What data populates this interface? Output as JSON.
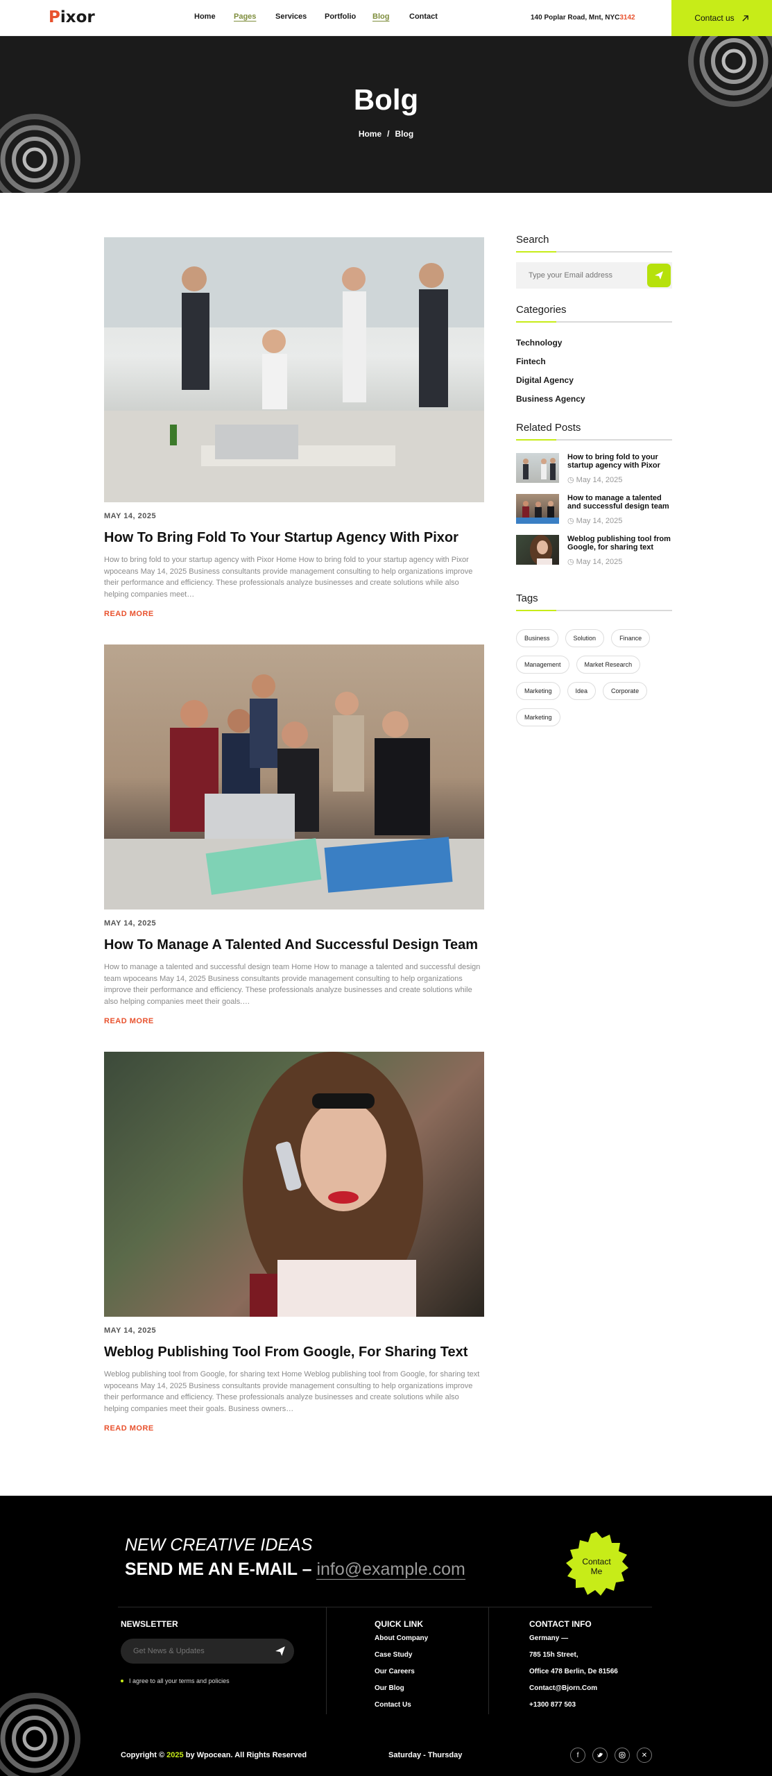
{
  "header": {
    "logo_initial": "P",
    "logo_rest": "ixor",
    "nav": [
      "Home",
      "Pages",
      "Services",
      "Portfolio",
      "Blog",
      "Contact"
    ],
    "address_main": "140 Poplar Road, Mnt, NYC",
    "address_accent": "3142",
    "contact_label": "Contact us",
    "accent_color": "#c7ec18",
    "brand_color": "#e8512d"
  },
  "hero": {
    "title": "Bolg",
    "crumb_home": "Home",
    "crumb_sep": "/",
    "crumb_current": "Blog"
  },
  "posts": [
    {
      "date": "MAY 14, 2025",
      "title": "How To Bring Fold To Your Startup Agency With Pixor",
      "excerpt": "How to bring fold to your startup agency with Pixor Home How to bring fold to your startup agency with Pixor wpoceans May 14, 2025 Business consultants provide management consulting to help organizations improve their performance and efficiency. These professionals analyze businesses and create solutions while also helping companies meet…",
      "read_more": "READ MORE"
    },
    {
      "date": "MAY 14, 2025",
      "title": "How To Manage A Talented And Successful Design Team",
      "excerpt": "How to manage a talented and successful design team Home How to manage a talented and successful design team wpoceans May 14, 2025 Business consultants provide management consulting to help organizations improve their performance and efficiency. These professionals analyze businesses and create solutions while also helping companies meet their goals.…",
      "read_more": "READ MORE"
    },
    {
      "date": "MAY 14, 2025",
      "title": "Weblog Publishing Tool From Google, For Sharing Text",
      "excerpt": "Weblog publishing tool from Google, for sharing text Home Weblog publishing tool from Google, for sharing text wpoceans May 14, 2025 Business consultants provide management consulting to help organizations improve their performance and efficiency. These professionals analyze businesses and create solutions while also helping companies meet their goals. Business owners…",
      "read_more": "READ MORE"
    }
  ],
  "sidebar": {
    "search_title": "Search",
    "search_placeholder": "Type your Email address",
    "categories_title": "Categories",
    "categories": [
      "Technology",
      "Fintech",
      "Digital Agency",
      "Business Agency"
    ],
    "related_title": "Related Posts",
    "related": [
      {
        "title": "How to bring fold to your startup agency with Pixor",
        "date": "May 14, 2025"
      },
      {
        "title": "How to manage a talented and successful design team",
        "date": "May 14, 2025"
      },
      {
        "title": "Weblog publishing tool from Google, for sharing text",
        "date": "May 14, 2025"
      }
    ],
    "tags_title": "Tags",
    "tags": [
      "Business",
      "Solution",
      "Finance",
      "Management",
      "Market Research",
      "Marketing",
      "Idea",
      "Corporate",
      "Marketing"
    ]
  },
  "footer": {
    "headline_italic": "NEW CREATIVE IDEAS",
    "headline_bold": "SEND ME AN E-MAIL –",
    "email": "info@example.com",
    "badge_label": "Contact Me",
    "newsletter_title": "NEWSLETTER",
    "newsletter_placeholder": "Get News & Updates",
    "agree_text": "I agree to all your terms and policies",
    "quick_title": "QUICK LINK",
    "quick_links": [
      "About Company",
      "Case Study",
      "Our Careers",
      "Our Blog",
      "Contact Us"
    ],
    "contact_title": "CONTACT INFO",
    "contact_lines": [
      "Germany —",
      "785 15h Street,",
      "Office 478 Berlin, De 81566",
      "Contact@Bjorn.Com",
      "+1300 877 503"
    ],
    "copyright_pre": "Copyright ©",
    "copyright_year": "2025",
    "copyright_post": "by Wpocean. All Rights Reserved",
    "hours": "Saturday - Thursday",
    "socials": [
      "facebook-icon",
      "twitter-icon",
      "instagram-icon",
      "x-icon"
    ]
  }
}
